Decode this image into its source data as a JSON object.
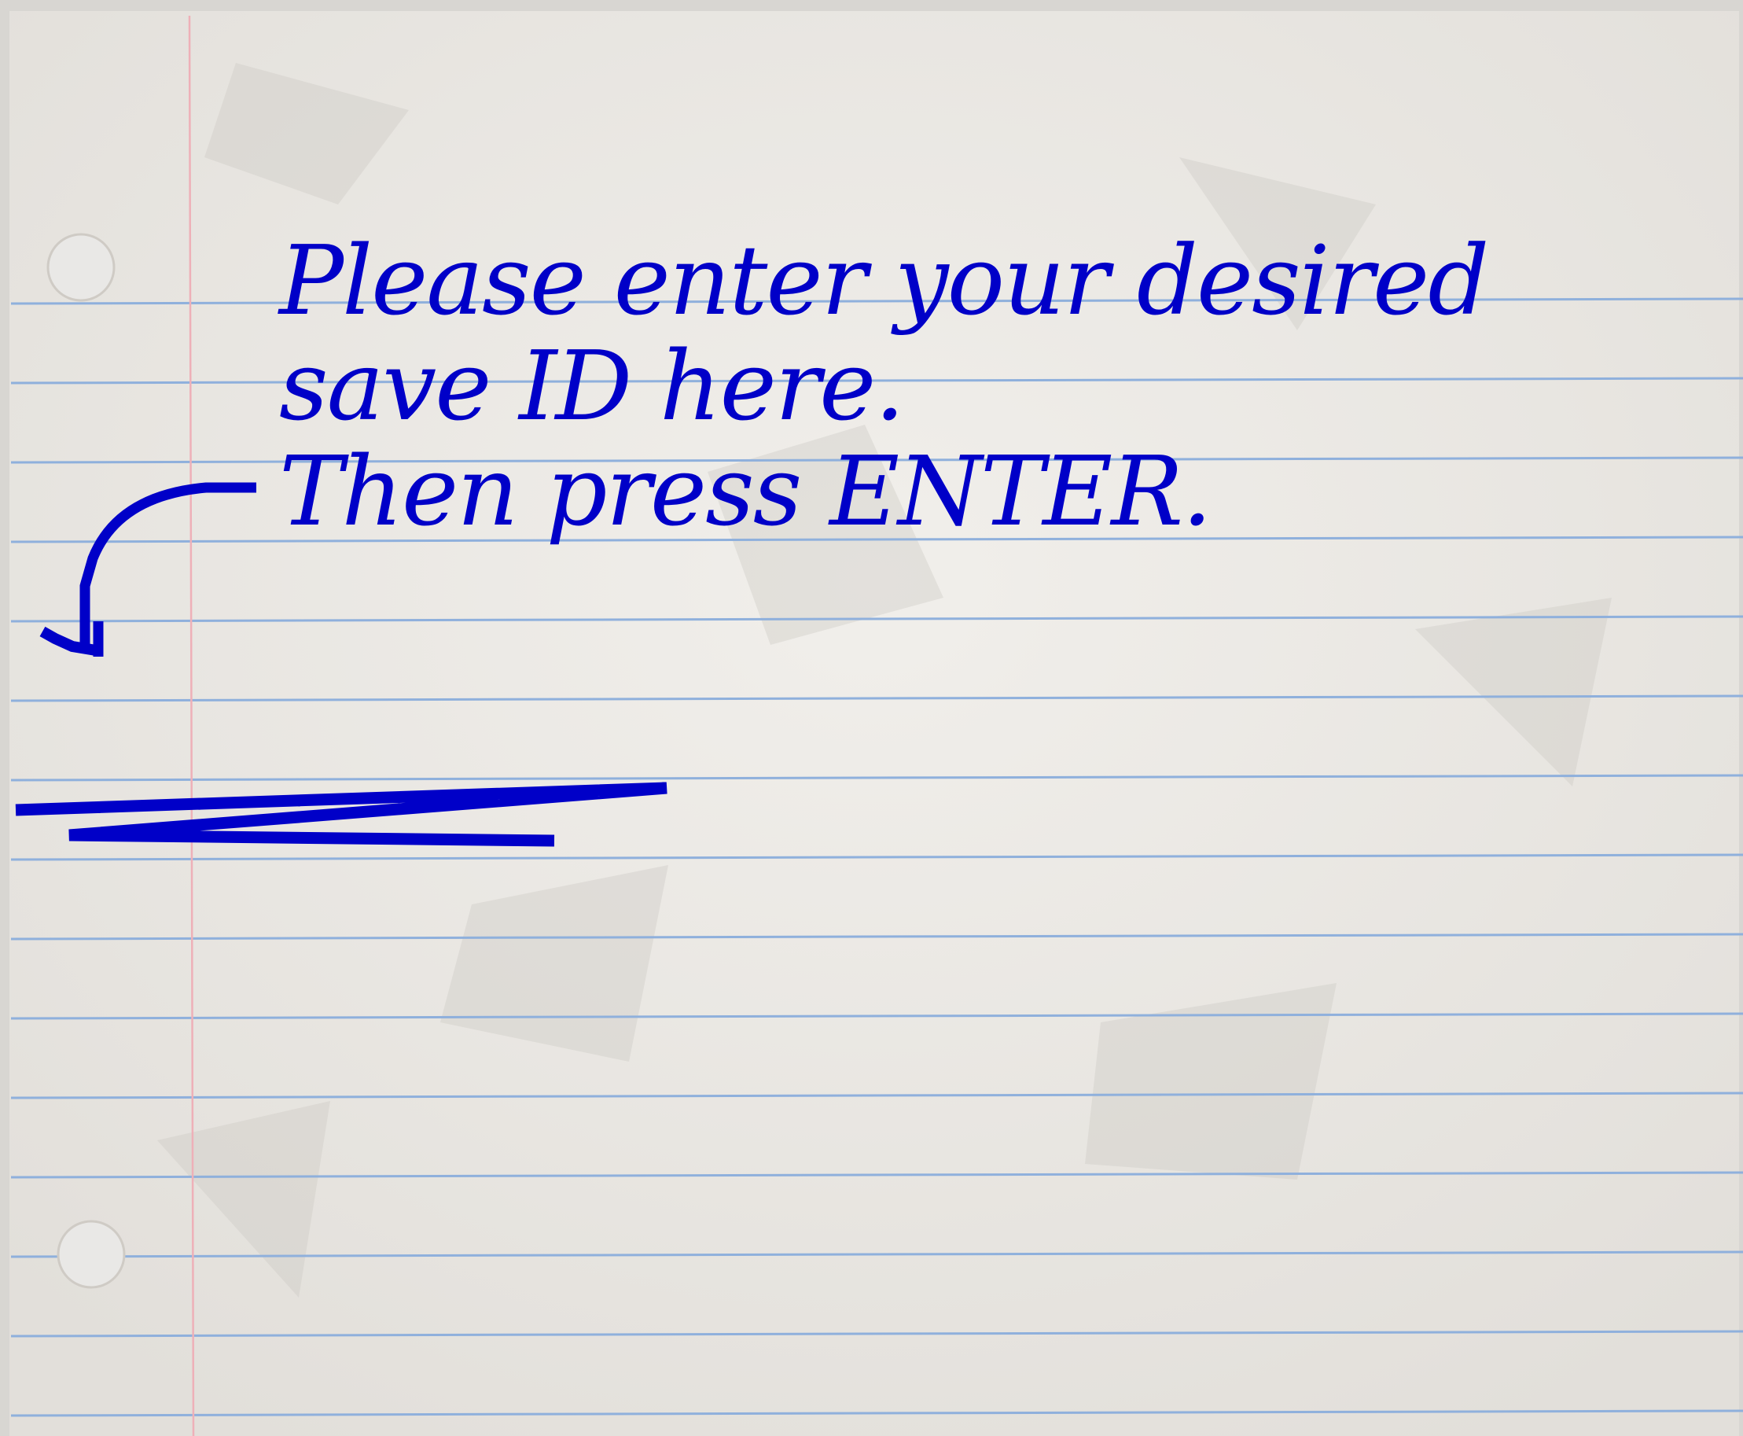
{
  "instructions": {
    "line1": "Please enter your desired",
    "line2": "save ID here.",
    "line3": "Then press ENTER."
  },
  "save_id_input": {
    "value": "",
    "placeholder": ""
  },
  "colors": {
    "ink": "#0000c8",
    "rule": "#8fb0dc",
    "margin": "#eeb0b8",
    "paper": "#ece9e4"
  },
  "icons": {
    "arrow": "curved-arrow-down-icon",
    "scribble": "scribble-mark"
  }
}
